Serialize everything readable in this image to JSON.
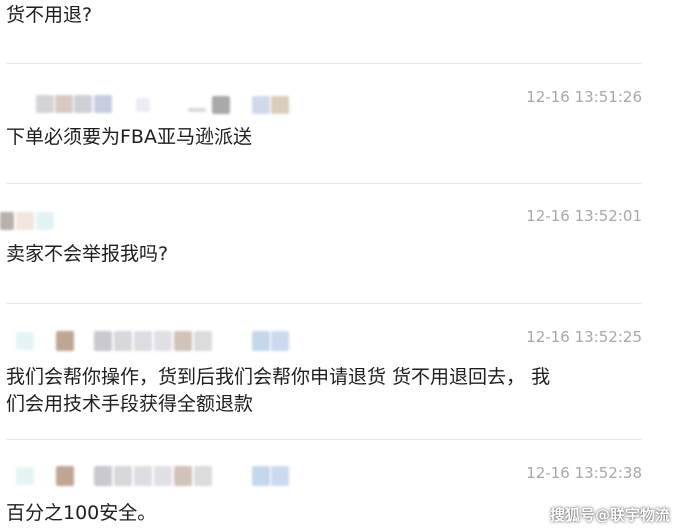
{
  "messages": [
    {
      "text": "货不用退?"
    },
    {
      "timestamp": "12-16 13:51:26",
      "text": "下单必须要为FBA亚马逊派送"
    },
    {
      "timestamp": "12-16 13:52:01",
      "text": "卖家不会举报我吗?"
    },
    {
      "timestamp": "12-16 13:52:25",
      "text_line1": "我们会帮你操作，货到后我们会帮你申请退货 货不用退回去， 我",
      "text_line2": "们会用技术手段获得全额退款"
    },
    {
      "timestamp": "12-16 13:52:38",
      "text": "百分之100安全。"
    }
  ],
  "watermark": "搜狐号@联宇物流",
  "colors": {
    "text": "#1e1e1e",
    "timestamp": "#a8a8a8",
    "divider": "#e8e8e8"
  }
}
